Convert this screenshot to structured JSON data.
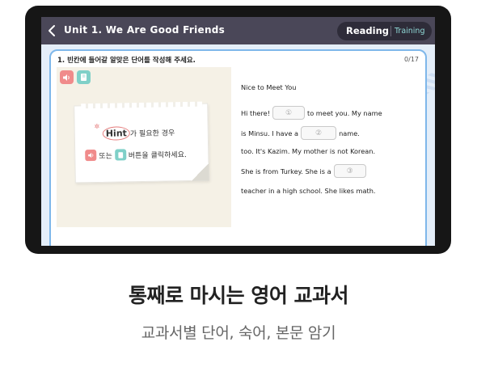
{
  "header": {
    "back_icon": "chevron-left-icon",
    "unit_title": "Unit 1. We Are Good Friends",
    "mode_reading": "Reading",
    "mode_training": "Training"
  },
  "exercise": {
    "instruction": "1. 빈칸에 들어갈 알맞은 단어를 작성해 주세요.",
    "counter": "0/17",
    "sound_icon": "speaker-icon",
    "book_icon": "book-icon"
  },
  "hint_note": {
    "hint_word": "Hint",
    "line1_rest": "가 필요한 경우",
    "line2_or": "또는",
    "line2_rest": "버튼을 클릭하세요."
  },
  "passage": {
    "title": "Nice to Meet You",
    "line1_before": "Hi there!",
    "blank1": "①",
    "line1_after": "to meet you. My name",
    "line2_before": "is Minsu. I have a",
    "blank2": "②",
    "line2_after": "name.",
    "line3": "too. It's Kazim. My mother is not Korean.",
    "line4_before": "She is from Turkey. She is a",
    "blank3": "③",
    "line5": "teacher in a high school. She likes math."
  },
  "marketing": {
    "headline": "통째로 마시는 영어 교과서",
    "subline": "교과서별 단어, 숙어, 본문 암기"
  },
  "colors": {
    "topbar": "#4a4758",
    "accent_teal": "#8fd8d6",
    "card_border": "#7eb7ea",
    "sound_button": "#f08b8b",
    "book_button": "#7fd0c8"
  }
}
